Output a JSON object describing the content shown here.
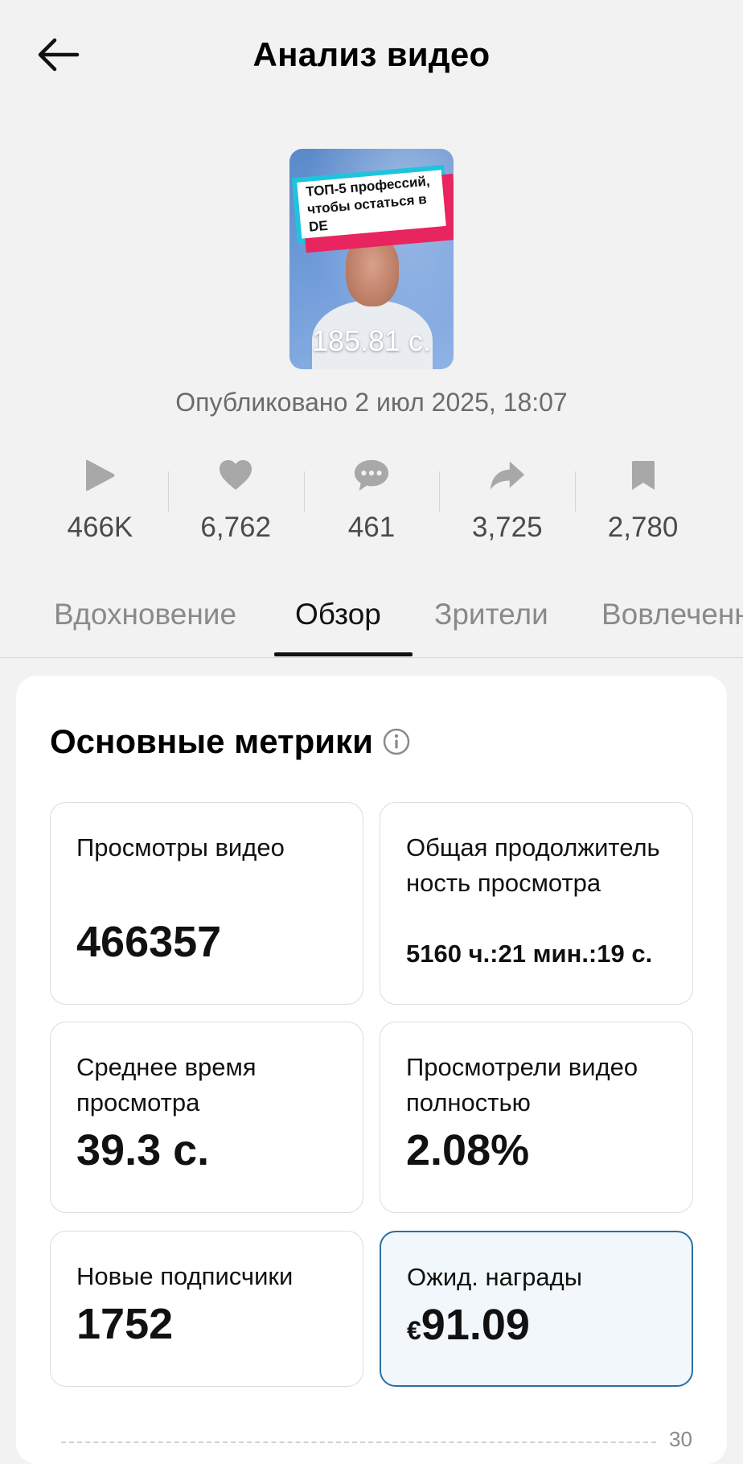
{
  "header": {
    "title": "Анализ видео",
    "back_icon": "arrow-left-icon"
  },
  "video": {
    "overlay_line1": "ТОП-5 профессий,",
    "overlay_line2": "чтобы остаться в DE",
    "duration": "185.81 с.",
    "published": "Опубликовано 2 июл 2025, 18:07"
  },
  "stats": [
    {
      "icon": "play-icon",
      "value": "466K"
    },
    {
      "icon": "heart-icon",
      "value": "6,762"
    },
    {
      "icon": "comment-icon",
      "value": "461"
    },
    {
      "icon": "share-icon",
      "value": "3,725"
    },
    {
      "icon": "bookmark-icon",
      "value": "2,780"
    }
  ],
  "tabs": [
    {
      "label": "Вдохновение",
      "active": false
    },
    {
      "label": "Обзор",
      "active": true
    },
    {
      "label": "Зрители",
      "active": false
    },
    {
      "label": "Вовлеченность",
      "active": false
    }
  ],
  "metrics_section": {
    "title": "Основные метрики",
    "info_icon": "info-icon",
    "metrics": [
      {
        "label": "Просмотры видео",
        "value": "466357"
      },
      {
        "label": "Общая продолжительность просмотра",
        "value": "5160 ч.:21 мин.:19 с."
      },
      {
        "label": "Среднее время просмотра",
        "value": "39.3 с."
      },
      {
        "label": "Просмотрели видео полностью",
        "value": "2.08%"
      },
      {
        "label": "Новые подписчики",
        "value": "1752"
      },
      {
        "label": "Ожид. награды",
        "currency": "€",
        "value": "91.09"
      }
    ]
  },
  "chart": {
    "tick_label": "30"
  },
  "colors": {
    "background": "#f2f2f2",
    "card": "#ffffff",
    "highlight_border": "#2a6fa1",
    "highlight_bg": "#f2f7fb",
    "muted_text": "#8a8a8a",
    "icon_gray": "#a8a8a8"
  }
}
